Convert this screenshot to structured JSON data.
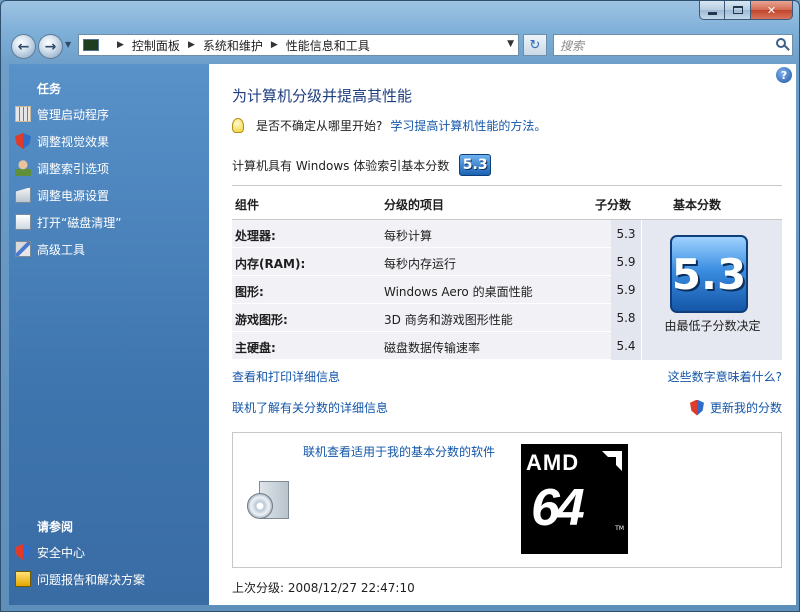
{
  "nav": {
    "breadcrumb": [
      "控制面板",
      "系统和维护",
      "性能信息和工具"
    ],
    "search_placeholder": "搜索"
  },
  "tasks": {
    "heading": "任务",
    "items": [
      {
        "label": "管理启动程序",
        "icon": "startup-icon"
      },
      {
        "label": "调整视觉效果",
        "icon": "shield-icon"
      },
      {
        "label": "调整索引选项",
        "icon": "index-icon"
      },
      {
        "label": "调整电源设置",
        "icon": "power-icon"
      },
      {
        "label": "打开“磁盘清理”",
        "icon": "disk-cleanup-icon"
      },
      {
        "label": "高级工具",
        "icon": "tools-icon"
      }
    ],
    "see_also_heading": "请参阅",
    "see_also": [
      {
        "label": "安全中心",
        "icon": "security-center-icon"
      },
      {
        "label": "问题报告和解决方案",
        "icon": "problem-report-icon"
      }
    ]
  },
  "content": {
    "title": "为计算机分级并提高其性能",
    "tip_question": "是否不确定从哪里开始?",
    "tip_link": "学习提高计算机性能的方法。",
    "base_score_label": "计算机具有 Windows 体验索引基本分数",
    "base_score": "5.3",
    "table": {
      "headers": {
        "component": "组件",
        "rated": "分级的项目",
        "subscore": "子分数",
        "base": "基本分数"
      },
      "rows": [
        {
          "component": "处理器:",
          "item": "每秒计算",
          "subscore": "5.3"
        },
        {
          "component": "内存(RAM):",
          "item": "每秒内存运行",
          "subscore": "5.9"
        },
        {
          "component": "图形:",
          "item": "Windows Aero 的桌面性能",
          "subscore": "5.9"
        },
        {
          "component": "游戏图形:",
          "item": "3D 商务和游戏图形性能",
          "subscore": "5.8"
        },
        {
          "component": "主硬盘:",
          "item": "磁盘数据传输速率",
          "subscore": "5.4"
        }
      ],
      "score_note": "由最低子分数决定"
    },
    "link_view_print": "查看和打印详细信息",
    "link_meaning": "这些数字意味着什么?",
    "link_online_details": "联机了解有关分数的详细信息",
    "link_update": "更新我的分数",
    "software_link": "联机查看适用于我的基本分数的软件",
    "amd_logo_text": "AMD",
    "amd_64": "64",
    "amd_tm": "TM",
    "last_rating": "上次分级: 2008/12/27 22:47:10"
  }
}
